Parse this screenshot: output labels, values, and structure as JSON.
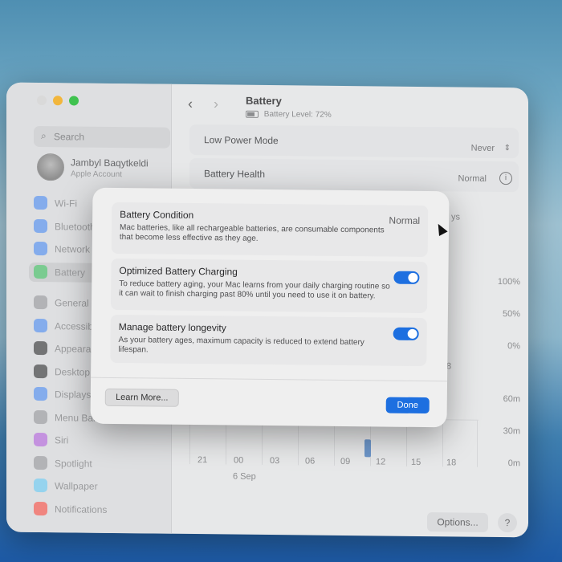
{
  "sidebar": {
    "search_placeholder": "Search",
    "account": {
      "name": "Jambyl Baqytkeldi",
      "subtitle": "Apple Account"
    },
    "items": [
      {
        "label": "Wi-Fi",
        "icon": "wifi-icon",
        "color": "#3b82f6"
      },
      {
        "label": "Bluetooth",
        "icon": "bluetooth-icon",
        "color": "#3b82f6"
      },
      {
        "label": "Network",
        "icon": "globe-icon",
        "color": "#3b82f6"
      },
      {
        "label": "Battery",
        "icon": "battery-icon",
        "color": "#34c759"
      },
      {
        "label": "General",
        "icon": "gear-icon",
        "color": "#8e8e93"
      },
      {
        "label": "Accessibility",
        "icon": "accessibility-icon",
        "color": "#3b82f6"
      },
      {
        "label": "Appearance",
        "icon": "appearance-icon",
        "color": "#1c1c1e"
      },
      {
        "label": "Desktop & Dock",
        "icon": "dock-icon",
        "color": "#1c1c1e"
      },
      {
        "label": "Displays",
        "icon": "display-icon",
        "color": "#3b82f6"
      },
      {
        "label": "Menu Bar",
        "icon": "menu-bar-icon",
        "color": "#8e8e93"
      },
      {
        "label": "Siri",
        "icon": "siri-icon",
        "color": "#af52de"
      },
      {
        "label": "Spotlight",
        "icon": "spotlight-icon",
        "color": "#8e8e93"
      },
      {
        "label": "Wallpaper",
        "icon": "wallpaper-icon",
        "color": "#5ac8fa"
      },
      {
        "label": "Notifications",
        "icon": "notifications-icon",
        "color": "#ff3b30"
      }
    ]
  },
  "header": {
    "title": "Battery",
    "battery_level": "Battery Level: 72%",
    "battery_fraction": 0.72
  },
  "main": {
    "low_power": {
      "label": "Low Power Mode",
      "value": "Never"
    },
    "health": {
      "label": "Battery Health",
      "value": "Normal"
    },
    "chart_pct": [
      "100%",
      "50%",
      "0%"
    ],
    "chart_min": [
      "60m",
      "30m",
      "0m"
    ],
    "x_ticks": [
      "21",
      "00",
      "03",
      "06",
      "09",
      "12",
      "15",
      "18"
    ],
    "date_label": "6 Sep",
    "partial_tab": "ys",
    "partial_number": "8",
    "options_label": "Options...",
    "help_label": "?"
  },
  "dialog": {
    "condition": {
      "title": "Battery Condition",
      "value": "Normal",
      "desc": "Mac batteries, like all rechargeable batteries, are consumable components that become less effective as they age."
    },
    "optimized": {
      "title": "Optimized Battery Charging",
      "desc": "To reduce battery aging, your Mac learns from your daily charging routine so it can wait to finish charging past 80% until you need to use it on battery.",
      "enabled": true
    },
    "longevity": {
      "title": "Manage battery longevity",
      "desc": "As your battery ages, maximum capacity is reduced to extend battery lifespan.",
      "enabled": true
    },
    "learn_more_label": "Learn More...",
    "done_label": "Done",
    "accent_color": "#1d6fe0"
  }
}
